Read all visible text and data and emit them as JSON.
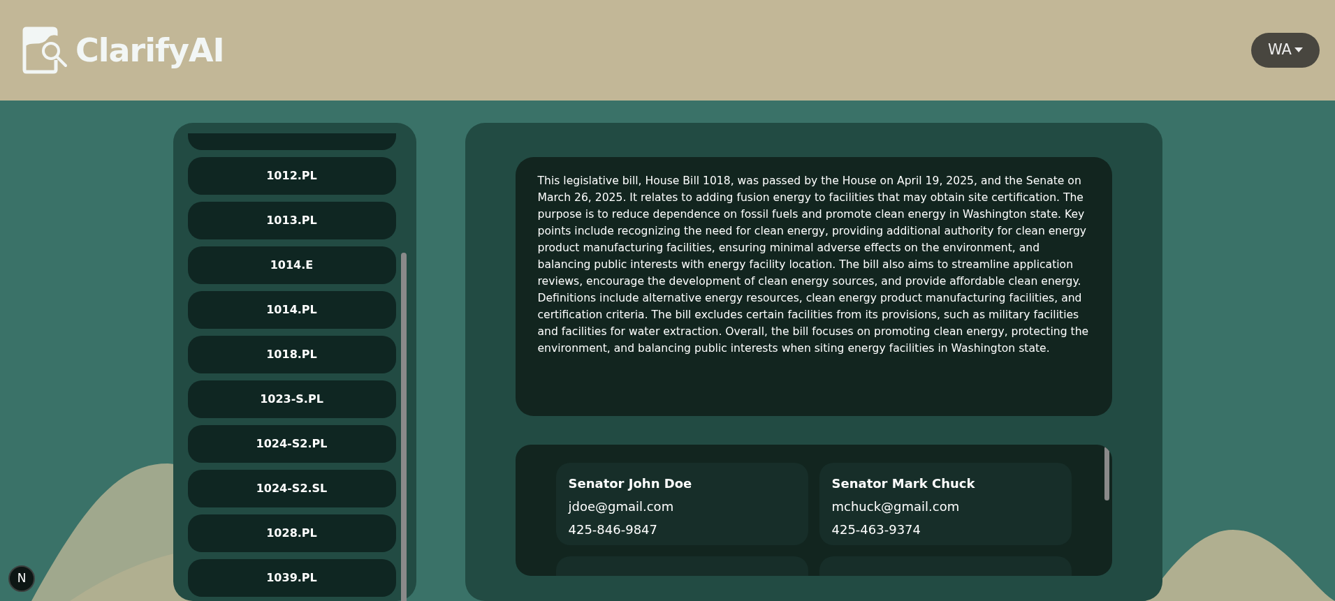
{
  "header": {
    "brand": "ClarifyAI",
    "state_selector": "WA"
  },
  "bills": [
    "1012.PL",
    "1013.PL",
    "1014.E",
    "1014.PL",
    "1018.PL",
    "1023-S.PL",
    "1024-S2.PL",
    "1024-S2.SL",
    "1028.PL",
    "1039.PL"
  ],
  "summary": "This legislative bill, House Bill 1018, was passed by the House on April 19, 2025, and the Senate on March 26, 2025. It relates to adding fusion energy to facilities that may obtain site certification. The purpose is to reduce dependence on fossil fuels and promote clean energy in Washington state. Key points include recognizing the need for clean energy, providing additional authority for clean energy product manufacturing facilities, ensuring minimal adverse effects on the environment, and balancing public interests with energy facility location. The bill also aims to streamline application reviews, encourage the development of clean energy sources, and provide affordable clean energy. Definitions include alternative energy resources, clean energy product manufacturing facilities, and certification criteria. The bill excludes certain facilities from its provisions, such as military facilities and facilities for water extraction. Overall, the bill focuses on promoting clean energy, protecting the environment, and balancing public interests when siting energy facilities in Washington state.",
  "senators": [
    {
      "name": "Senator John Doe",
      "email": "jdoe@gmail.com",
      "phone": "425-846-9847"
    },
    {
      "name": "Senator Mark Chuck",
      "email": "mchuck@gmail.com",
      "phone": "425-463-9374"
    }
  ],
  "dev_badge": "N"
}
